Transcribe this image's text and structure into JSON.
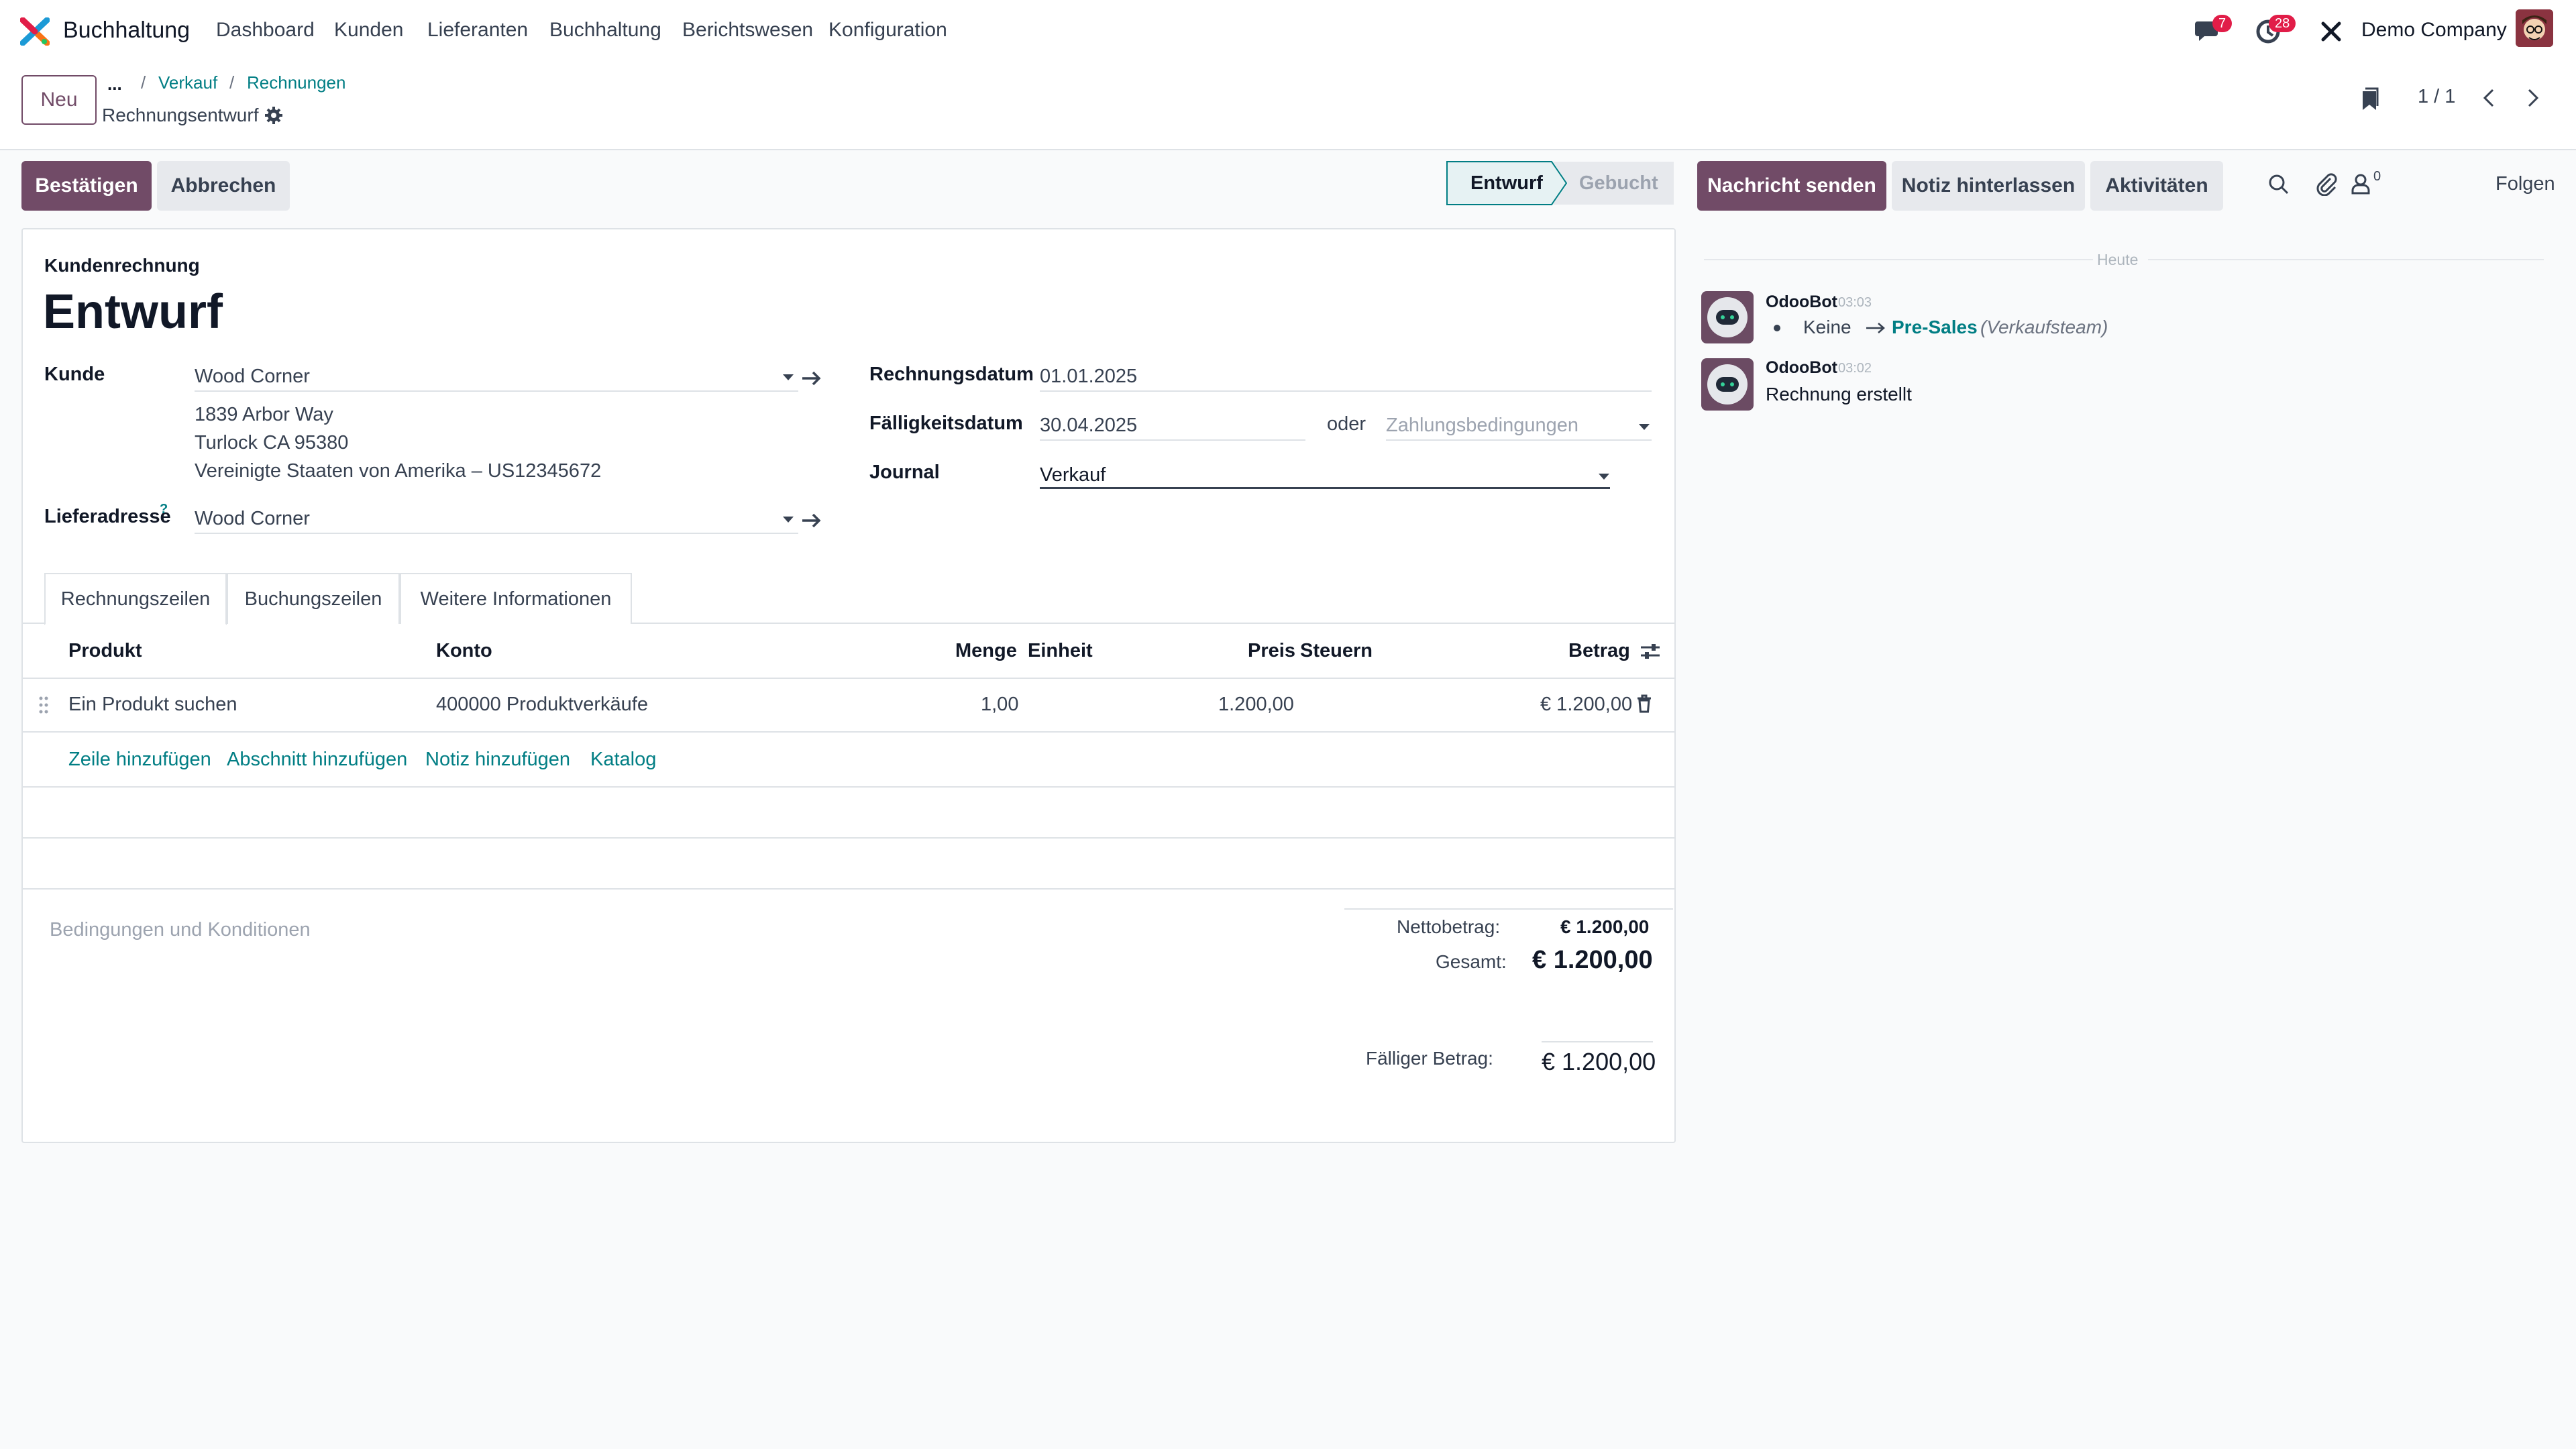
{
  "navbar": {
    "app_name": "Buchhaltung",
    "menu": [
      "Dashboard",
      "Kunden",
      "Lieferanten",
      "Buchhaltung",
      "Berichtswesen",
      "Konfiguration"
    ],
    "messages_count": "7",
    "activities_count": "28",
    "company": "Demo Company"
  },
  "control": {
    "new_label": "Neu",
    "more": "...",
    "breadcrumb": [
      "Verkauf",
      "Rechnungen"
    ],
    "record_title": "Rechnungsentwurf",
    "pager": "1 / 1"
  },
  "actions": {
    "confirm": "Bestätigen",
    "cancel": "Abbrechen",
    "status": [
      "Entwurf",
      "Gebucht"
    ],
    "send_message": "Nachricht senden",
    "log_note": "Notiz hinterlassen",
    "activities": "Aktivitäten",
    "followers_count": "0",
    "follow": "Folgen"
  },
  "form": {
    "move_type": "Kundenrechnung",
    "name": "Entwurf",
    "customer_label": "Kunde",
    "customer": "Wood Corner",
    "address": [
      "1839 Arbor Way",
      "Turlock CA 95380",
      "Vereinigte Staaten von Amerika – US12345672"
    ],
    "delivery_label": "Lieferadresse",
    "delivery_help": "?",
    "delivery": "Wood Corner",
    "invoice_date_label": "Rechnungsdatum",
    "invoice_date": "01.01.2025",
    "due_date_label": "Fälligkeitsdatum",
    "due_date": "30.04.2025",
    "or": "oder",
    "payment_terms_placeholder": "Zahlungsbedingungen",
    "journal_label": "Journal",
    "journal": "Verkauf"
  },
  "tabs": [
    "Rechnungszeilen",
    "Buchungszeilen",
    "Weitere Informationen"
  ],
  "lines": {
    "headers": {
      "product": "Produkt",
      "account": "Konto",
      "quantity": "Menge",
      "uom": "Einheit",
      "price": "Preis",
      "taxes": "Steuern",
      "amount": "Betrag"
    },
    "rows": [
      {
        "product": "Ein Produkt suchen",
        "account": "400000 Produktverkäufe",
        "quantity": "1,00",
        "uom": "",
        "price": "1.200,00",
        "taxes": "",
        "amount": "€ 1.200,00"
      }
    ],
    "add_line": "Zeile hinzufügen",
    "add_section": "Abschnitt hinzufügen",
    "add_note": "Notiz hinzufügen",
    "catalog": "Katalog"
  },
  "terms_placeholder": "Bedingungen und Konditionen",
  "totals": {
    "net_label": "Nettobetrag:",
    "net": "€ 1.200,00",
    "total_label": "Gesamt:",
    "total": "€ 1.200,00",
    "residual_label": "Fälliger Betrag:",
    "residual": "€ 1.200,00"
  },
  "chatter": {
    "day_separator": "Heute",
    "messages": [
      {
        "author": "OdooBot",
        "time": "03:03",
        "old": "Keine",
        "new": "Pre-Sales",
        "field": "(Verkaufsteam)"
      },
      {
        "author": "OdooBot",
        "time": "03:02",
        "body": "Rechnung erstellt"
      }
    ]
  },
  "colors": {
    "brand": "#714b67",
    "link": "#017e84",
    "badge": "#e11d48"
  }
}
